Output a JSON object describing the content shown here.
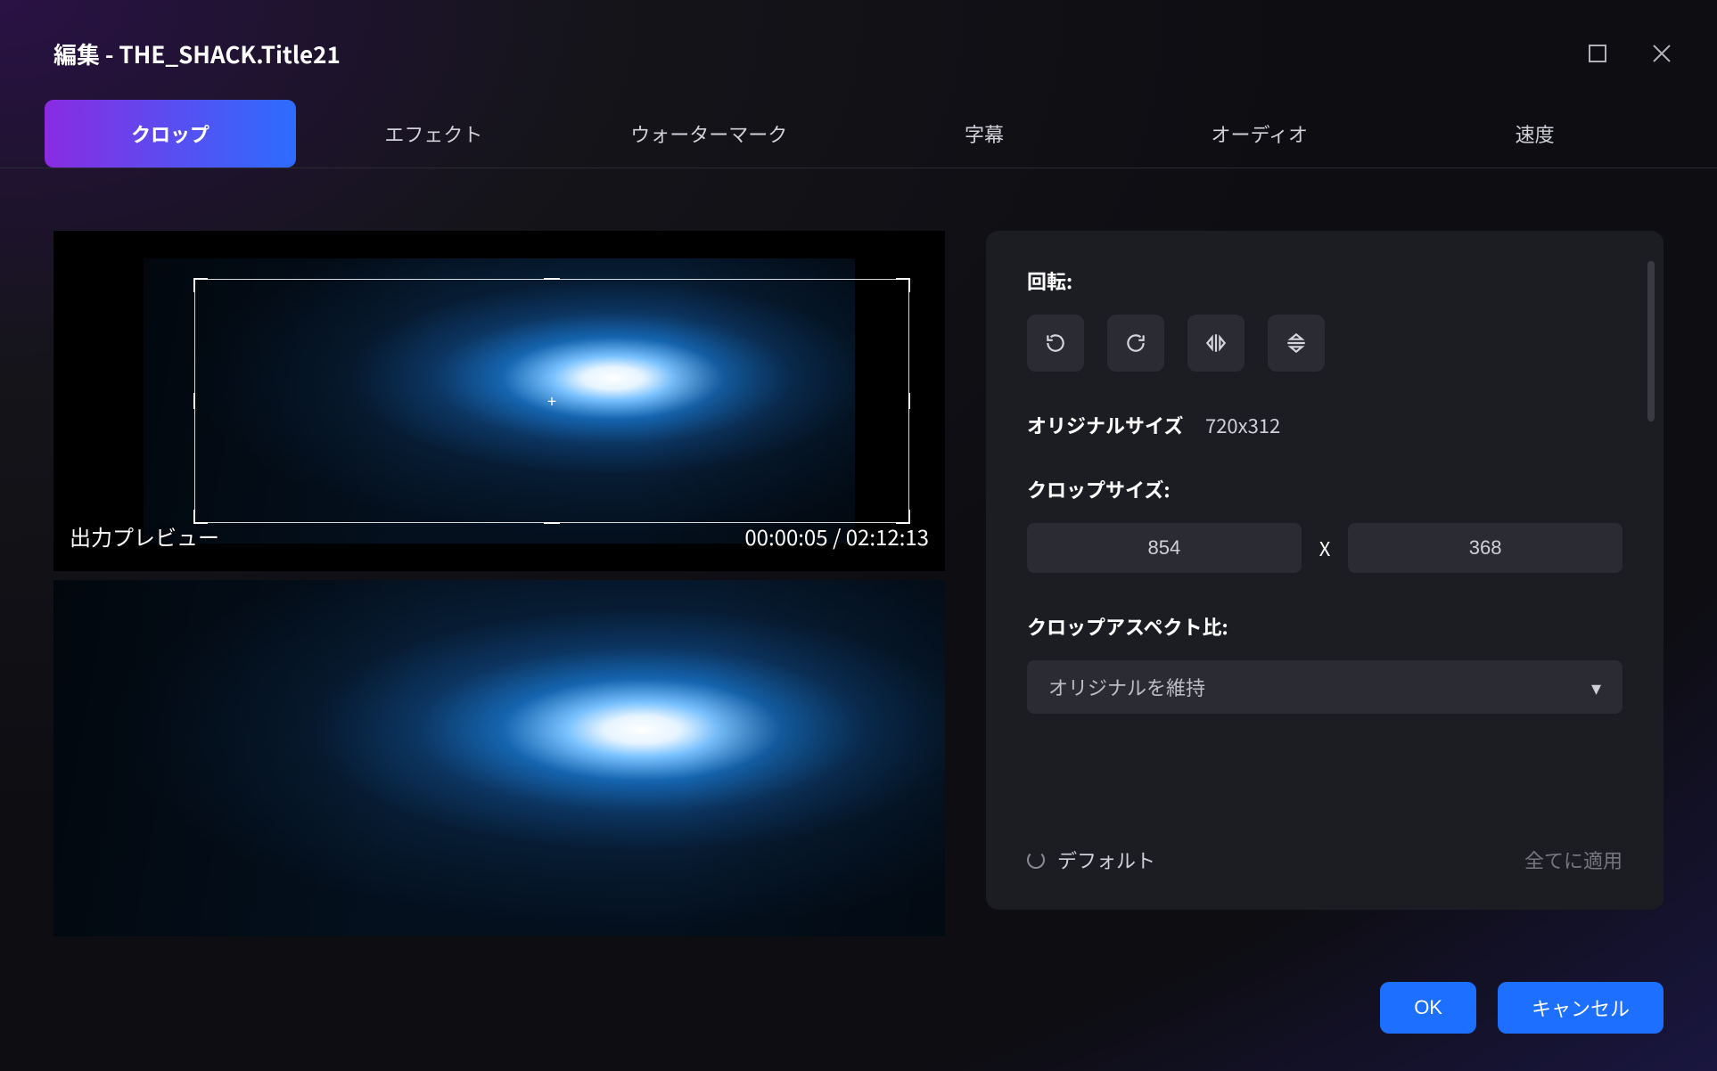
{
  "window": {
    "title": "編集 - THE_SHACK.Title21"
  },
  "tabs": {
    "crop": "クロップ",
    "effect": "エフェクト",
    "watermark": "ウォーターマーク",
    "subtitle": "字幕",
    "audio": "オーディオ",
    "speed": "速度"
  },
  "preview": {
    "output_label": "出力プレビュー",
    "timecode": "00:00:05 / 02:12:13"
  },
  "panel": {
    "rotate_label": "回転:",
    "original_size_label": "オリジナルサイズ",
    "original_size_value": "720x312",
    "crop_size_label": "クロップサイズ:",
    "crop_width": "854",
    "crop_height": "368",
    "size_separator": "X",
    "aspect_label": "クロップアスペクト比:",
    "aspect_selected": "オリジナルを維持",
    "default": "デフォルト",
    "apply_all": "全てに適用"
  },
  "buttons": {
    "ok": "OK",
    "cancel": "キャンセル"
  }
}
